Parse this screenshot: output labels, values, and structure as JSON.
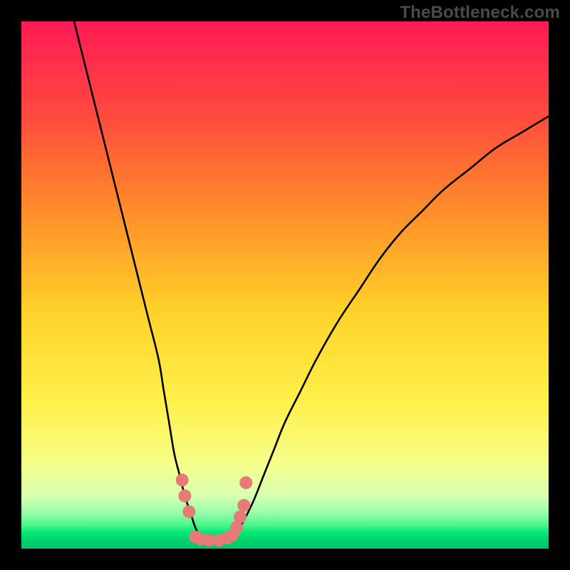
{
  "watermark": "TheBottleneck.com",
  "chart_data": {
    "type": "line",
    "title": "",
    "xlabel": "",
    "ylabel": "",
    "xlim": [
      0,
      100
    ],
    "ylim": [
      0,
      100
    ],
    "background_gradient": {
      "top": "#ff1a55",
      "upper_mid": "#ff7a2a",
      "mid": "#ffe22a",
      "lower_mid": "#f2ff8a",
      "bottom_band_top": "#d6ff9a",
      "bottom_band_mid": "#7aff9a",
      "bottom_band_low": "#00e874",
      "very_bottom": "#00c86a"
    },
    "series": [
      {
        "name": "left-curve",
        "stroke": "#000000",
        "x": [
          10,
          12,
          14,
          16,
          18,
          20,
          22,
          24,
          26,
          27,
          28,
          29,
          30,
          31,
          32,
          33,
          34
        ],
        "y": [
          100,
          92,
          84,
          76,
          68,
          60,
          52,
          44,
          36,
          30,
          24,
          18,
          14,
          10,
          7,
          4,
          2
        ]
      },
      {
        "name": "right-curve",
        "stroke": "#000000",
        "x": [
          40,
          42,
          44,
          46,
          48,
          50,
          53,
          56,
          60,
          64,
          68,
          72,
          76,
          80,
          85,
          90,
          95,
          100
        ],
        "y": [
          2,
          5,
          9,
          14,
          19,
          24,
          30,
          36,
          43,
          49,
          55,
          60,
          64,
          68,
          72,
          76,
          79,
          82
        ]
      }
    ],
    "marker_series": {
      "name": "trough-dots",
      "color": "#e77a77",
      "radius_px": 9,
      "points": [
        {
          "x": 30.5,
          "y": 13
        },
        {
          "x": 31.0,
          "y": 10
        },
        {
          "x": 31.8,
          "y": 7
        },
        {
          "x": 33.0,
          "y": 2.2
        },
        {
          "x": 34.0,
          "y": 1.8
        },
        {
          "x": 35.5,
          "y": 1.6
        },
        {
          "x": 37.5,
          "y": 1.6
        },
        {
          "x": 39.0,
          "y": 2.0
        },
        {
          "x": 40.0,
          "y": 2.5
        },
        {
          "x": 40.8,
          "y": 4.0
        },
        {
          "x": 41.5,
          "y": 6.0
        },
        {
          "x": 42.2,
          "y": 8.2
        },
        {
          "x": 42.6,
          "y": 12.5
        }
      ]
    }
  }
}
